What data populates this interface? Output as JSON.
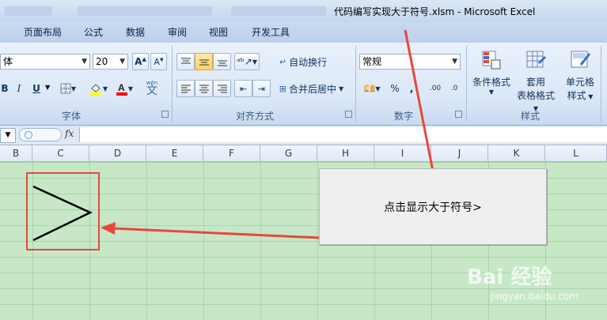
{
  "window": {
    "title": "代码编写实现大于符号.xlsm - Microsoft Excel"
  },
  "tabs": [
    "页面布局",
    "公式",
    "数据",
    "审阅",
    "视图",
    "开发工具"
  ],
  "font_group": {
    "font_name": "体",
    "font_size": "20",
    "bold": "B",
    "italic": "I",
    "underline": "U",
    "phonetic_top": "wén",
    "phonetic": "文",
    "label": "字体"
  },
  "align_group": {
    "wrap_label": "自动换行",
    "merge_label": "合并后居中",
    "label": "对齐方式"
  },
  "number_group": {
    "format": "常规",
    "percent": "%",
    "comma": ",",
    "inc_decimal": ".00",
    "dec_decimal": ".0",
    "label": "数字"
  },
  "style_group": {
    "conditional_format": "条件格式",
    "table_format_line1": "套用",
    "table_format_line2": "表格格式",
    "cell_style_line1": "单元格",
    "cell_style_line2": "样式",
    "label": "样式"
  },
  "formula_bar": {
    "fx": "fx"
  },
  "columns": [
    "B",
    "C",
    "D",
    "E",
    "F",
    "G",
    "H",
    "I",
    "J",
    "K",
    "L"
  ],
  "shape_button": {
    "label": "点击显示大于符号>"
  },
  "watermark": {
    "logo": "Bai 经验",
    "url": "jingyan.baidu.com"
  },
  "colors": {
    "annotation_red": "#e8473c",
    "grid_bg": "#c6e8c6",
    "ribbon_accent": "#3b5a86"
  }
}
